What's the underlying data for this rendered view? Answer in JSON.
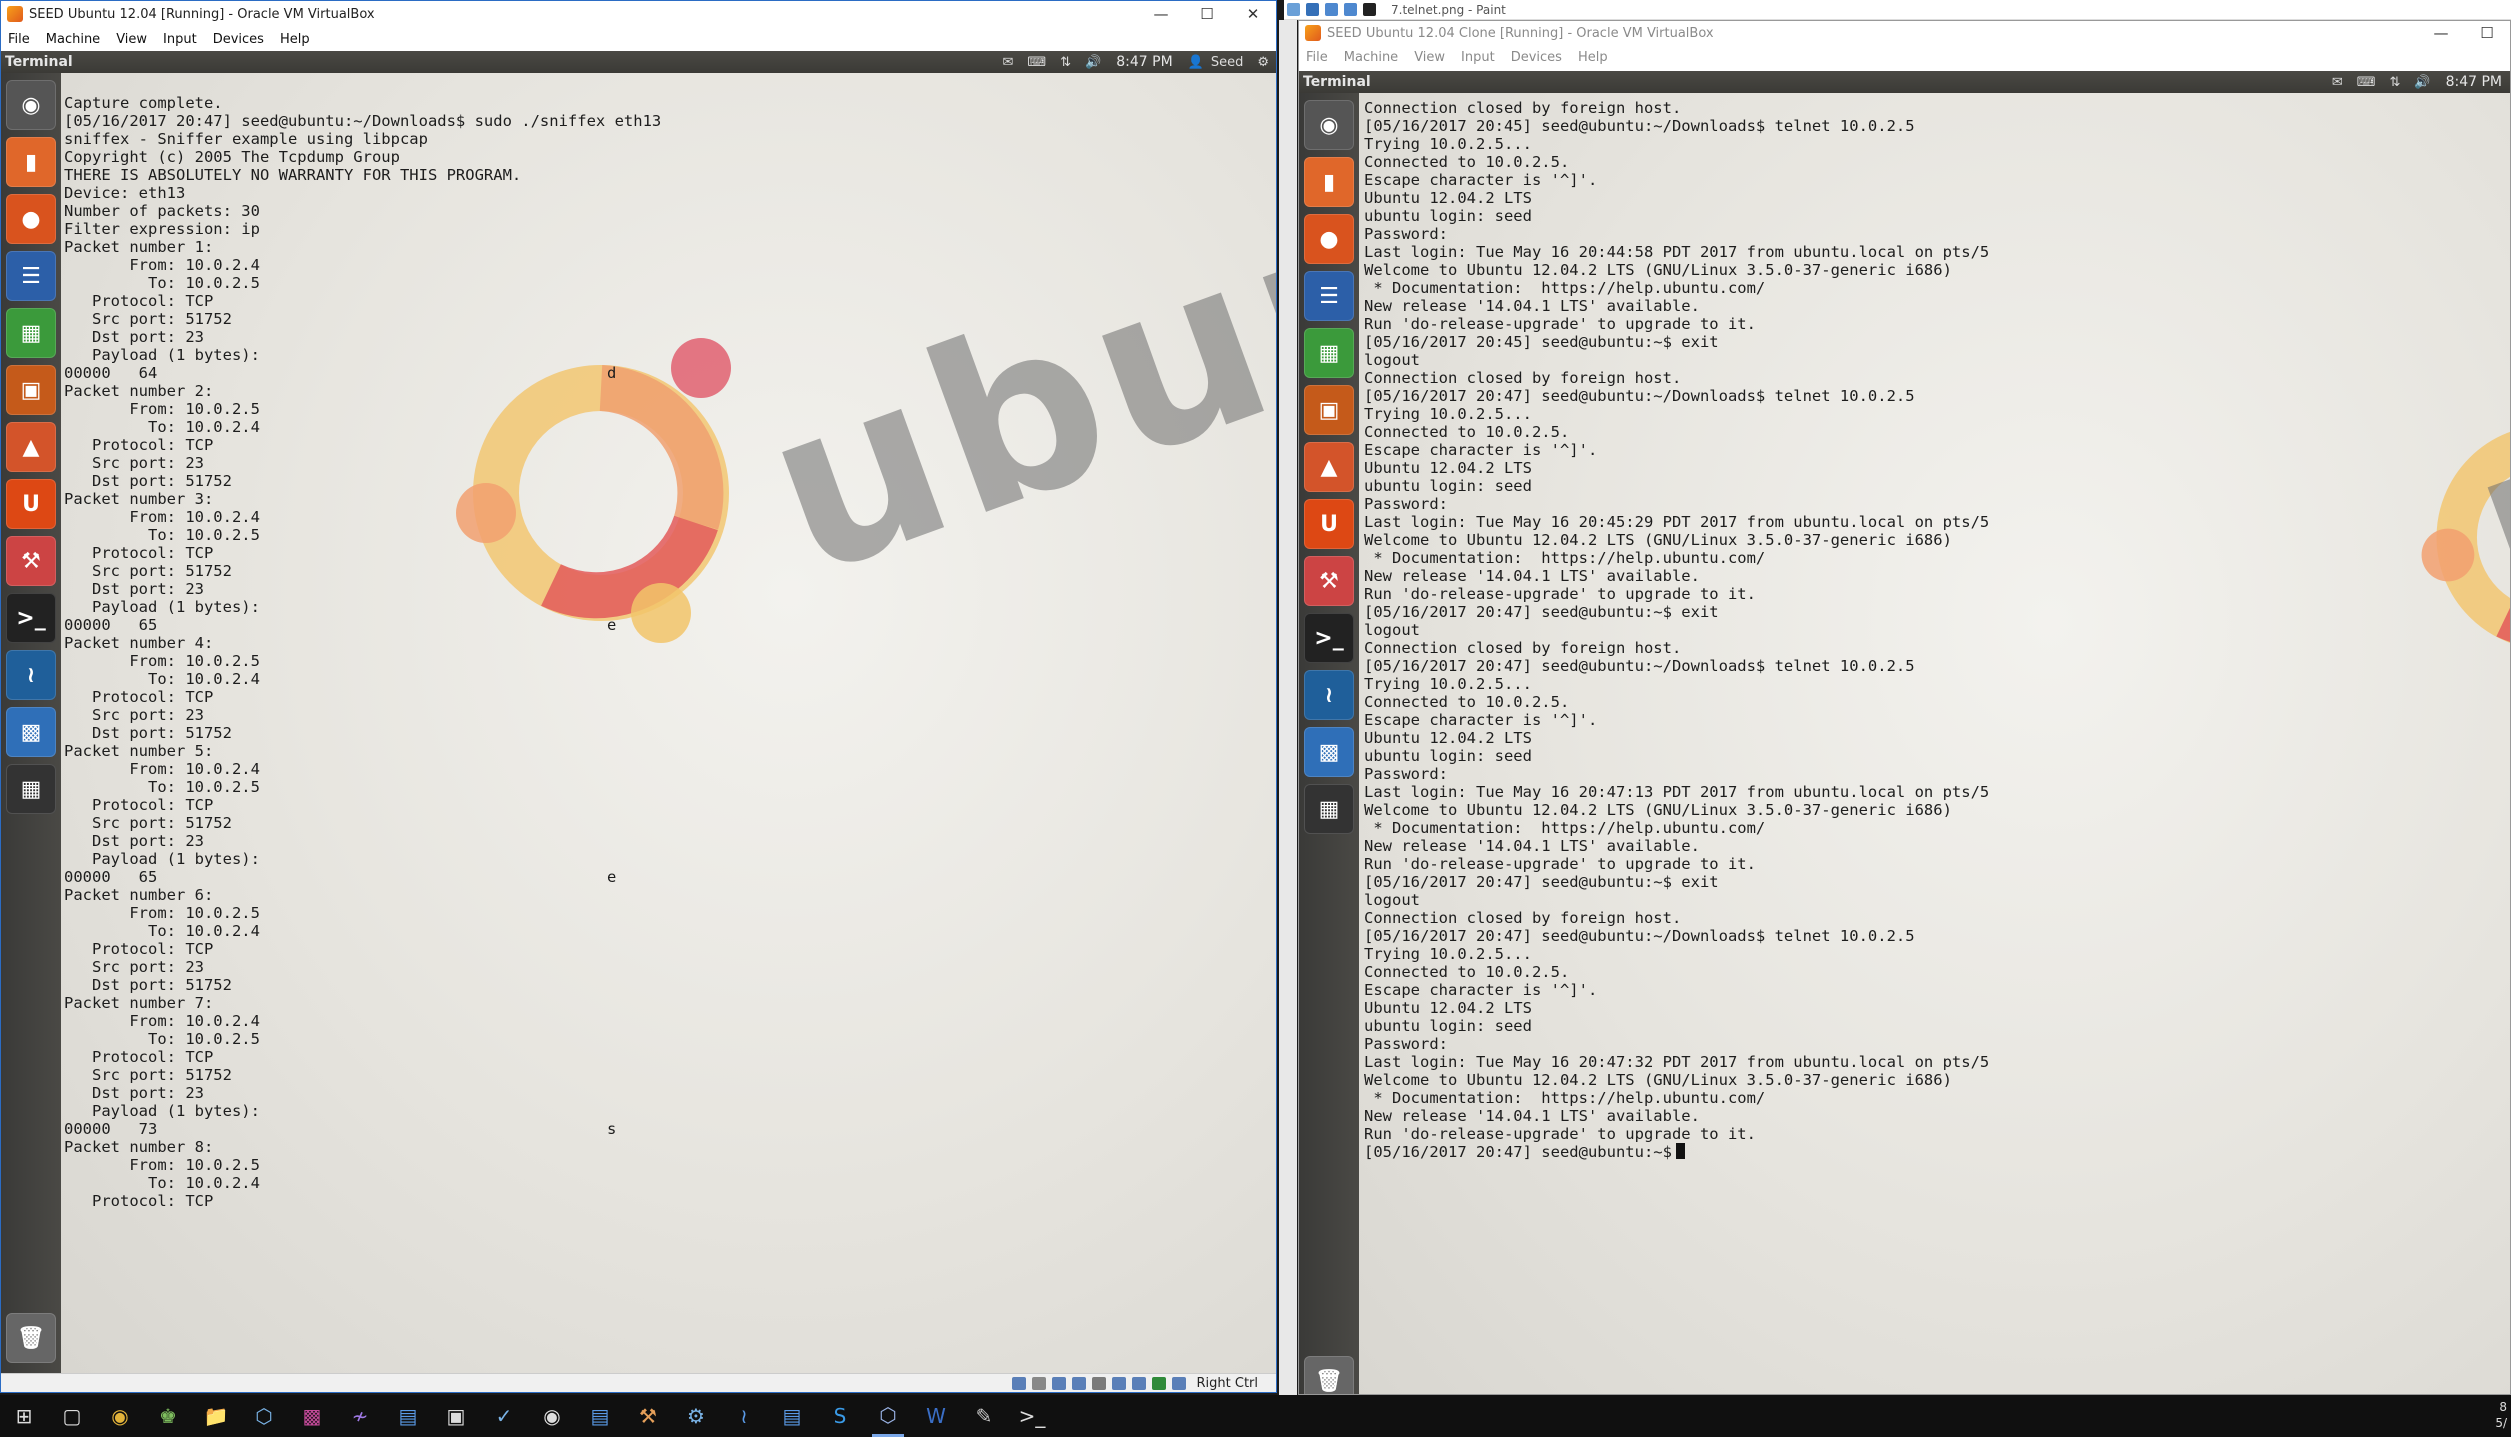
{
  "left_vm": {
    "window_title": "SEED Ubuntu 12.04 [Running] - Oracle VM VirtualBox",
    "menu": [
      "File",
      "Machine",
      "View",
      "Input",
      "Devices",
      "Help"
    ],
    "panel": {
      "title": "Terminal",
      "time": "8:47 PM",
      "user": "Seed"
    },
    "terminal_lines": [
      "Capture complete.",
      "[05/16/2017 20:47] seed@ubuntu:~/Downloads$ sudo ./sniffex eth13",
      "sniffex - Sniffer example using libpcap",
      "Copyright (c) 2005 The Tcpdump Group",
      "THERE IS ABSOLUTELY NO WARRANTY FOR THIS PROGRAM.",
      "",
      "Device: eth13",
      "Number of packets: 30",
      "Filter expression: ip",
      "",
      "Packet number 1:",
      "       From: 10.0.2.4",
      "         To: 10.0.2.5",
      "   Protocol: TCP",
      "   Src port: 51752",
      "   Dst port: 23",
      "   Payload (1 bytes):",
      "00000   64",
      "",
      "Packet number 2:",
      "       From: 10.0.2.5",
      "         To: 10.0.2.4",
      "   Protocol: TCP",
      "   Src port: 23",
      "   Dst port: 51752",
      "",
      "Packet number 3:",
      "       From: 10.0.2.4",
      "         To: 10.0.2.5",
      "   Protocol: TCP",
      "   Src port: 51752",
      "   Dst port: 23",
      "   Payload (1 bytes):",
      "00000   65",
      "",
      "Packet number 4:",
      "       From: 10.0.2.5",
      "         To: 10.0.2.4",
      "   Protocol: TCP",
      "   Src port: 23",
      "   Dst port: 51752",
      "",
      "Packet number 5:",
      "       From: 10.0.2.4",
      "         To: 10.0.2.5",
      "   Protocol: TCP",
      "   Src port: 51752",
      "   Dst port: 23",
      "   Payload (1 bytes):",
      "00000   65",
      "",
      "Packet number 6:",
      "       From: 10.0.2.5",
      "         To: 10.0.2.4",
      "   Protocol: TCP",
      "   Src port: 23",
      "   Dst port: 51752",
      "",
      "Packet number 7:",
      "       From: 10.0.2.4",
      "         To: 10.0.2.5",
      "   Protocol: TCP",
      "   Src port: 51752",
      "   Dst port: 23",
      "   Payload (1 bytes):",
      "00000   73",
      "",
      "Packet number 8:",
      "       From: 10.0.2.5",
      "         To: 10.0.2.4",
      "   Protocol: TCP"
    ],
    "payload_chars": [
      {
        "line": 17,
        "char": "d"
      },
      {
        "line": 33,
        "char": "e"
      },
      {
        "line": 49,
        "char": "e"
      },
      {
        "line": 65,
        "char": "s"
      }
    ],
    "status_host_key": "Right Ctrl",
    "wallpaper_word": "ubun"
  },
  "right_vm": {
    "window_title": "SEED Ubuntu 12.04 Clone [Running] - Oracle VM VirtualBox",
    "menu": [
      "File",
      "Machine",
      "View",
      "Input",
      "Devices",
      "Help"
    ],
    "panel": {
      "title": "Terminal",
      "time": "8:47 PM"
    },
    "terminal_lines": [
      "Connection closed by foreign host.",
      "[05/16/2017 20:45] seed@ubuntu:~/Downloads$ telnet 10.0.2.5",
      "Trying 10.0.2.5...",
      "Connected to 10.0.2.5.",
      "Escape character is '^]'.",
      "Ubuntu 12.04.2 LTS",
      "ubuntu login: seed",
      "Password:",
      "Last login: Tue May 16 20:44:58 PDT 2017 from ubuntu.local on pts/5",
      "Welcome to Ubuntu 12.04.2 LTS (GNU/Linux 3.5.0-37-generic i686)",
      "",
      " * Documentation:  https://help.ubuntu.com/",
      "",
      "New release '14.04.1 LTS' available.",
      "Run 'do-release-upgrade' to upgrade to it.",
      "",
      "[05/16/2017 20:45] seed@ubuntu:~$ exit",
      "logout",
      "Connection closed by foreign host.",
      "[05/16/2017 20:47] seed@ubuntu:~/Downloads$ telnet 10.0.2.5",
      "Trying 10.0.2.5...",
      "Connected to 10.0.2.5.",
      "Escape character is '^]'.",
      "Ubuntu 12.04.2 LTS",
      "ubuntu login: seed",
      "Password:",
      "Last login: Tue May 16 20:45:29 PDT 2017 from ubuntu.local on pts/5",
      "Welcome to Ubuntu 12.04.2 LTS (GNU/Linux 3.5.0-37-generic i686)",
      "",
      " * Documentation:  https://help.ubuntu.com/",
      "",
      "New release '14.04.1 LTS' available.",
      "Run 'do-release-upgrade' to upgrade to it.",
      "",
      "[05/16/2017 20:47] seed@ubuntu:~$ exit",
      "logout",
      "Connection closed by foreign host.",
      "[05/16/2017 20:47] seed@ubuntu:~/Downloads$ telnet 10.0.2.5",
      "Trying 10.0.2.5...",
      "Connected to 10.0.2.5.",
      "Escape character is '^]'.",
      "Ubuntu 12.04.2 LTS",
      "ubuntu login: seed",
      "Password:",
      "Last login: Tue May 16 20:47:13 PDT 2017 from ubuntu.local on pts/5",
      "Welcome to Ubuntu 12.04.2 LTS (GNU/Linux 3.5.0-37-generic i686)",
      "",
      " * Documentation:  https://help.ubuntu.com/",
      "",
      "New release '14.04.1 LTS' available.",
      "Run 'do-release-upgrade' to upgrade to it.",
      "",
      "[05/16/2017 20:47] seed@ubuntu:~$ exit",
      "logout",
      "Connection closed by foreign host.",
      "[05/16/2017 20:47] seed@ubuntu:~/Downloads$ telnet 10.0.2.5",
      "Trying 10.0.2.5...",
      "Connected to 10.0.2.5.",
      "Escape character is '^]'.",
      "Ubuntu 12.04.2 LTS",
      "ubuntu login: seed",
      "Password:",
      "Last login: Tue May 16 20:47:32 PDT 2017 from ubuntu.local on pts/5",
      "Welcome to Ubuntu 12.04.2 LTS (GNU/Linux 3.5.0-37-generic i686)",
      "",
      " * Documentation:  https://help.ubuntu.com/",
      "",
      "New release '14.04.1 LTS' available.",
      "Run 'do-release-upgrade' to upgrade to it.",
      "",
      "[05/16/2017 20:47] seed@ubuntu:~$"
    ],
    "wallpaper_word": "ubun"
  },
  "paint": {
    "title": "7.telnet.png - Paint"
  },
  "taskbar": {
    "clock_line1": "8",
    "clock_line2": "5/"
  },
  "colors": {
    "accent": "#2b6cc4",
    "ubuntu_orange": "#e95420",
    "panel": "#3b3a36"
  }
}
